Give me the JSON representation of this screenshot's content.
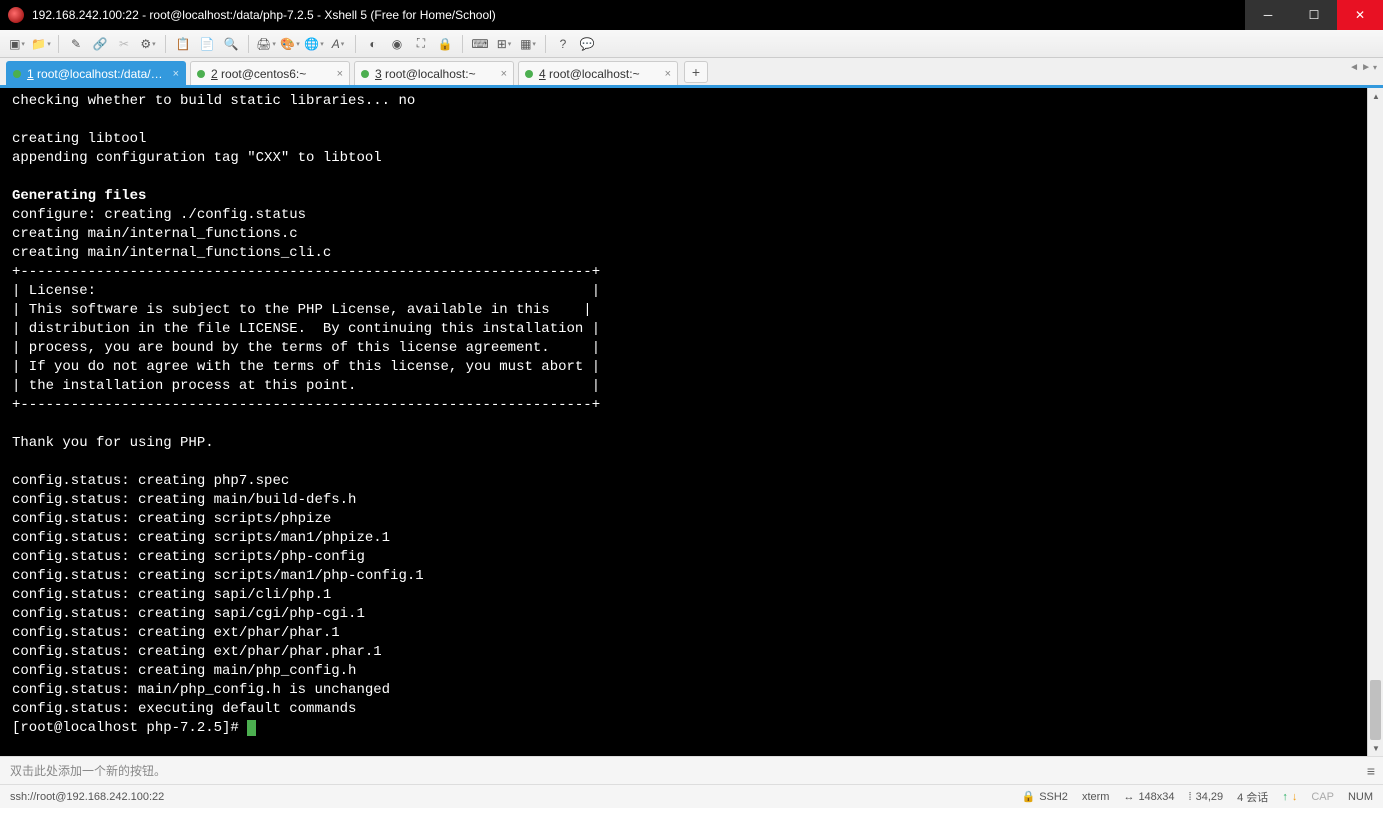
{
  "window": {
    "title": "192.168.242.100:22 - root@localhost:/data/php-7.2.5 - Xshell 5 (Free for Home/School)"
  },
  "tabs": [
    {
      "num": "1",
      "label": " root@localhost:/data/php-...",
      "active": true
    },
    {
      "num": "2",
      "label": " root@centos6:~",
      "active": false
    },
    {
      "num": "3",
      "label": " root@localhost:~",
      "active": false
    },
    {
      "num": "4",
      "label": " root@localhost:~",
      "active": false
    }
  ],
  "terminal": {
    "lines_before": "checking whether to build static libraries... no\n\ncreating libtool\nappending configuration tag \"CXX\" to libtool\n",
    "heading": "Generating files",
    "lines_after": "configure: creating ./config.status\ncreating main/internal_functions.c\ncreating main/internal_functions_cli.c\n+--------------------------------------------------------------------+\n| License:                                                           |\n| This software is subject to the PHP License, available in this    |\n| distribution in the file LICENSE.  By continuing this installation |\n| process, you are bound by the terms of this license agreement.     |\n| If you do not agree with the terms of this license, you must abort |\n| the installation process at this point.                            |\n+--------------------------------------------------------------------+\n\nThank you for using PHP.\n\nconfig.status: creating php7.spec\nconfig.status: creating main/build-defs.h\nconfig.status: creating scripts/phpize\nconfig.status: creating scripts/man1/phpize.1\nconfig.status: creating scripts/php-config\nconfig.status: creating scripts/man1/php-config.1\nconfig.status: creating sapi/cli/php.1\nconfig.status: creating sapi/cgi/php-cgi.1\nconfig.status: creating ext/phar/phar.1\nconfig.status: creating ext/phar/phar.phar.1\nconfig.status: creating main/php_config.h\nconfig.status: main/php_config.h is unchanged\nconfig.status: executing default commands",
    "prompt": "[root@localhost php-7.2.5]# "
  },
  "quickbar": {
    "hint": "双击此处添加一个新的按钮。"
  },
  "status": {
    "connection": "ssh://root@192.168.242.100:22",
    "protocol": "SSH2",
    "term": "xterm",
    "size": "148x34",
    "pos": "34,29",
    "sessions": "4 会话",
    "caps": "CAP",
    "num": "NUM"
  }
}
